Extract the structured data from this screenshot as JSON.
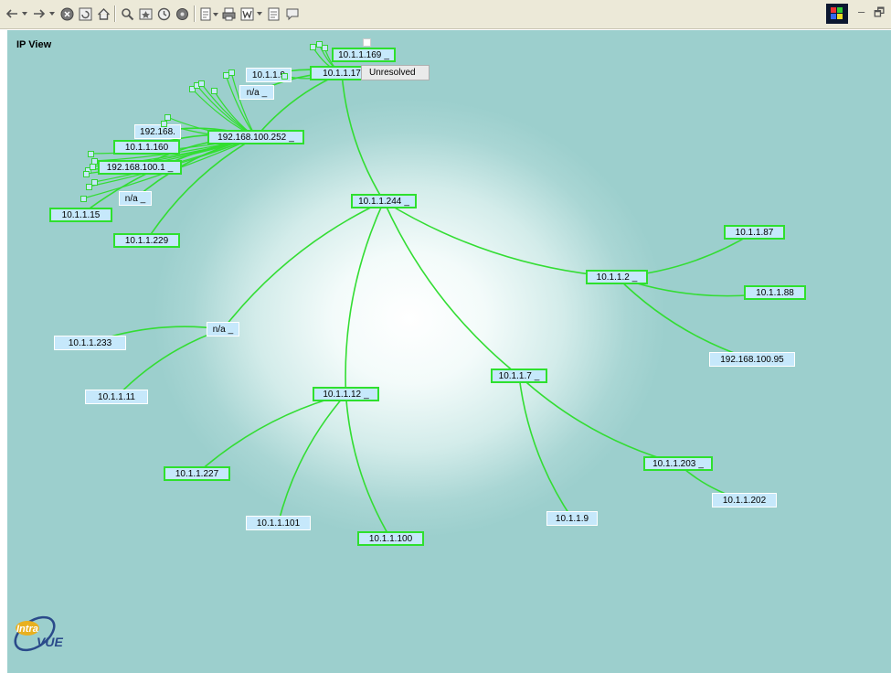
{
  "toolbar": {
    "icons": [
      "back-arrow-icon",
      "dropdown-icon",
      "forward-arrow-icon",
      "dropdown-icon",
      "stop-icon",
      "refresh-icon",
      "home-icon",
      "search-icon",
      "favorites-icon",
      "history-icon",
      "media-icon",
      "edit-icon",
      "print-icon",
      "word-icon",
      "discuss-icon",
      "messenger-icon"
    ],
    "minimize_glyph": "–",
    "restore_glyph": "🗗"
  },
  "view": {
    "title": "IP View",
    "tooltip": "Unresolved",
    "expand_glyph": "_"
  },
  "colors": {
    "link": "#33dd33",
    "node_fill": "#c6e8fb",
    "node_border_active": "#2ee02e",
    "background": "#9ccfcd"
  },
  "nodes": [
    {
      "id": "n169",
      "label": "10.1.1.169",
      "expand": true
    },
    {
      "id": "n17",
      "label": "10.1.1.17",
      "expand": false
    },
    {
      "id": "n9top",
      "label": "10.1.1.9",
      "expand": false
    },
    {
      "id": "nna1",
      "label": "n/a",
      "expand": true
    },
    {
      "id": "n192a",
      "label": "192.168.",
      "expand": false
    },
    {
      "id": "n252",
      "label": "192.168.100.252",
      "expand": true
    },
    {
      "id": "n160",
      "label": "10.1.1.160",
      "expand": false
    },
    {
      "id": "n1001",
      "label": "192.168.100.1",
      "expand": true
    },
    {
      "id": "nna2",
      "label": "n/a",
      "expand": true
    },
    {
      "id": "n15",
      "label": "10.1.1.15",
      "expand": false
    },
    {
      "id": "n229",
      "label": "10.1.1.229",
      "expand": false
    },
    {
      "id": "n244",
      "label": "10.1.1.244",
      "expand": true
    },
    {
      "id": "n87",
      "label": "10.1.1.87",
      "expand": false
    },
    {
      "id": "n2",
      "label": "10.1.1.2",
      "expand": true
    },
    {
      "id": "n88",
      "label": "10.1.1.88",
      "expand": false
    },
    {
      "id": "n95",
      "label": "192.168.100.95",
      "expand": false
    },
    {
      "id": "nna3",
      "label": "n/a",
      "expand": true
    },
    {
      "id": "n233",
      "label": "10.1.1.233",
      "expand": false
    },
    {
      "id": "n11",
      "label": "10.1.1.11",
      "expand": false
    },
    {
      "id": "n12",
      "label": "10.1.1.12",
      "expand": true
    },
    {
      "id": "n7",
      "label": "10.1.1.7",
      "expand": true
    },
    {
      "id": "n227",
      "label": "10.1.1.227",
      "expand": false
    },
    {
      "id": "n101",
      "label": "10.1.1.101",
      "expand": false
    },
    {
      "id": "n100",
      "label": "10.1.1.100",
      "expand": false
    },
    {
      "id": "n203",
      "label": "10.1.1.203",
      "expand": true
    },
    {
      "id": "n202",
      "label": "10.1.1.202",
      "expand": false
    },
    {
      "id": "n9",
      "label": "10.1.1.9",
      "expand": false
    }
  ],
  "links": [
    [
      "n17",
      "n244"
    ],
    [
      "n244",
      "nna3"
    ],
    [
      "nna3",
      "n233"
    ],
    [
      "nna3",
      "n11"
    ],
    [
      "n244",
      "n12"
    ],
    [
      "n12",
      "n227"
    ],
    [
      "n12",
      "n101"
    ],
    [
      "n12",
      "n100"
    ],
    [
      "n244",
      "n7"
    ],
    [
      "n7",
      "n9"
    ],
    [
      "n7",
      "n203"
    ],
    [
      "n203",
      "n202"
    ],
    [
      "n244",
      "n2"
    ],
    [
      "n2",
      "n87"
    ],
    [
      "n2",
      "n88"
    ],
    [
      "n2",
      "n95"
    ],
    [
      "n17",
      "n252"
    ],
    [
      "n17",
      "n9top"
    ],
    [
      "n17",
      "nna1"
    ],
    [
      "n252",
      "n192a"
    ],
    [
      "n252",
      "n160"
    ],
    [
      "n252",
      "n1001"
    ],
    [
      "n252",
      "nna2"
    ],
    [
      "n252",
      "n15"
    ],
    [
      "n252",
      "n229"
    ]
  ],
  "logo": {
    "text_top": "Intra",
    "text_bottom": "VUE"
  }
}
